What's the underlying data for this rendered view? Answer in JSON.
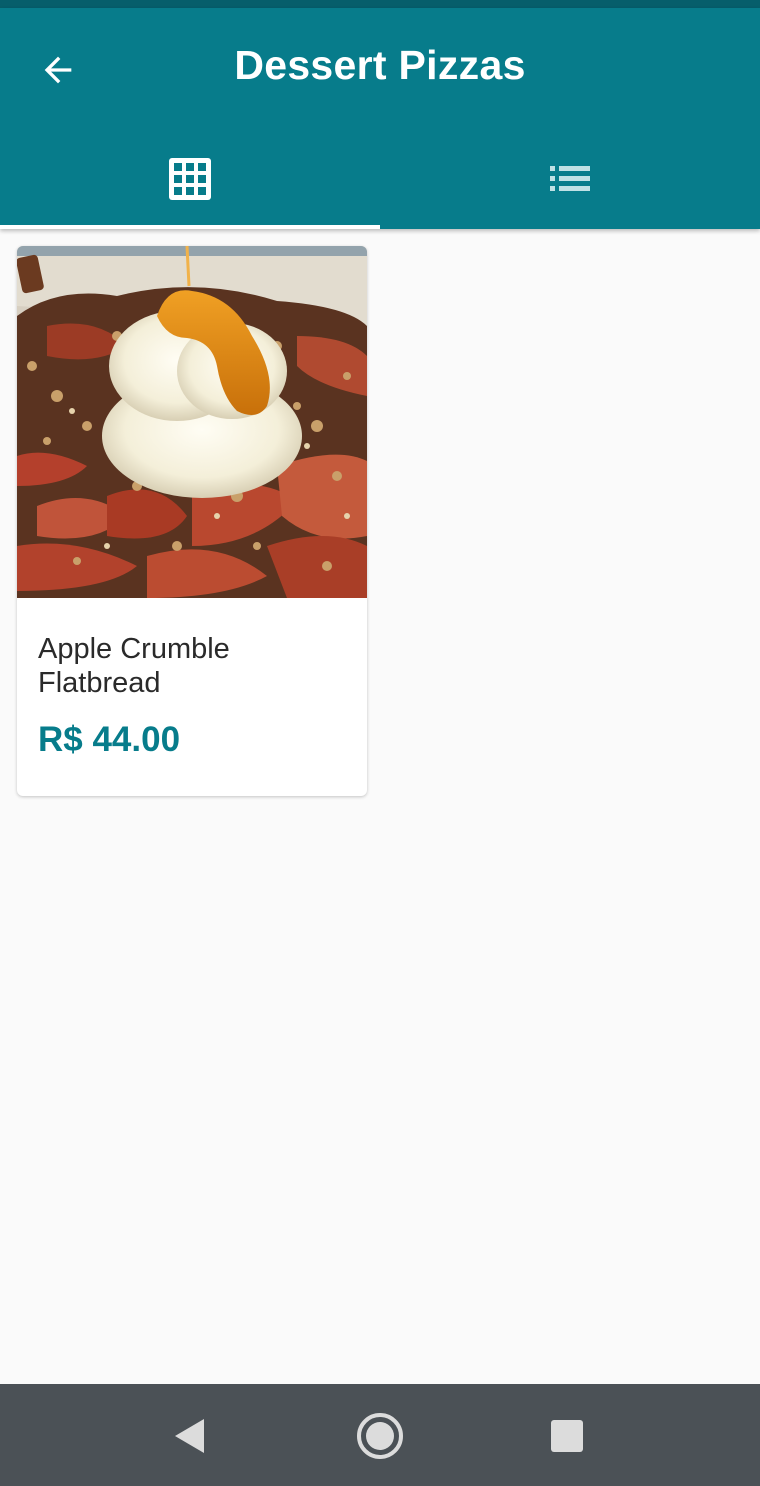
{
  "app": {
    "title": "Dessert Pizzas",
    "accent_color": "#077c8b"
  },
  "appbar": {
    "back_icon": "arrow-left-icon",
    "tabs": [
      {
        "icon": "grid-view-icon",
        "selected": true
      },
      {
        "icon": "list-view-icon",
        "selected": false
      }
    ]
  },
  "products": [
    {
      "name": "Apple Crumble Flatbread",
      "price": "R$ 44.00",
      "image": "apple-crumble-flatbread-photo"
    }
  ],
  "system_nav": {
    "back_icon": "nav-back-icon",
    "home_icon": "nav-home-icon",
    "recents_icon": "nav-recents-icon"
  }
}
